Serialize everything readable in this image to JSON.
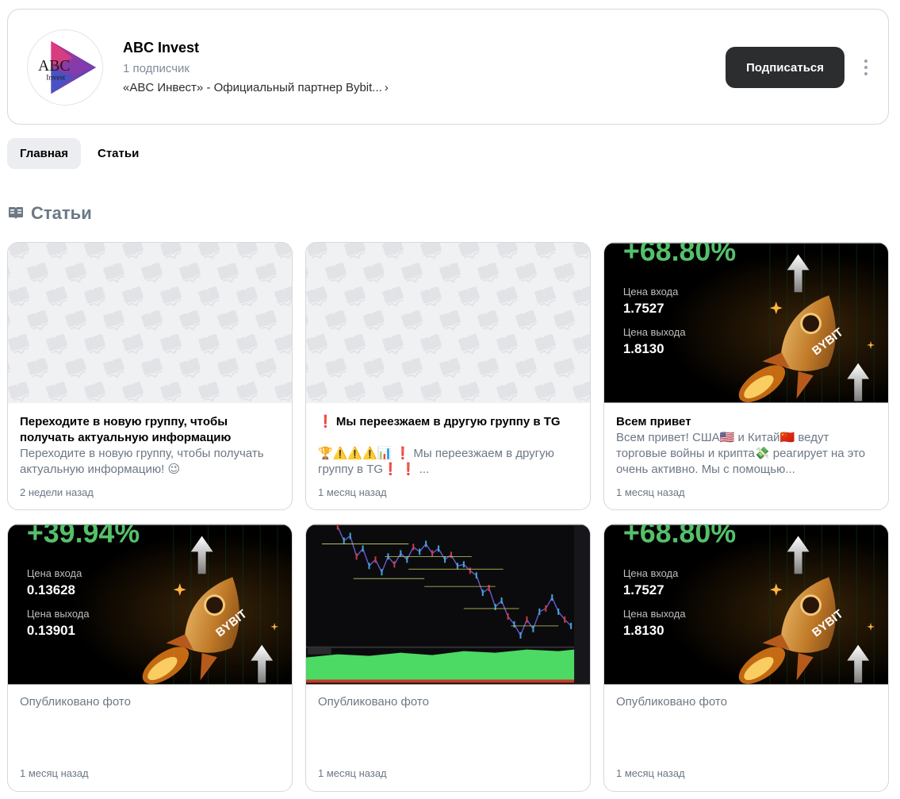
{
  "group": {
    "name": "ABC Invest",
    "subscribers": "1 подписчик",
    "description": "«ABC Инвест» -  Официальный партнер Bybit...",
    "logo_text_top": "ABC",
    "logo_text_bottom": "Invest",
    "subscribe_label": "Подписаться"
  },
  "tabs": [
    {
      "label": "Главная",
      "active": true
    },
    {
      "label": "Статьи",
      "active": false
    }
  ],
  "section": {
    "title": "Статьи",
    "icon": "book-icon"
  },
  "cards": [
    {
      "thumb": "placeholder",
      "title": "Переходите в новую группу, чтобы получать актуальную информацию",
      "body": "Переходите в новую группу, чтобы получать актуальную информацию! 😉",
      "time": "2 недели назад"
    },
    {
      "thumb": "placeholder",
      "title": "❗ Мы переезжаем в другую группу в TG",
      "body": "🏆⚠️⚠️⚠️📊 ❗ Мы переезжаем в другую группу в TG❗ ❗ ...",
      "time": "1 месяц назад"
    },
    {
      "thumb": "trade",
      "title": "Всем привет",
      "body": "Всем привет! США🇺🇸 и Китай🇨🇳 ведут торговые войны и крипта💸 реагирует на это очень активно. Мы с помощью...",
      "time": "1 месяц назад",
      "trade": {
        "percent": "+68.80%",
        "entry_label": "Цена входа",
        "entry": "1.7527",
        "exit_label": "Цена выхода",
        "exit": "1.8130",
        "brand": "BYBIT"
      }
    },
    {
      "thumb": "trade",
      "title": "",
      "body": "Опубликовано фото",
      "time": "1 месяц назад",
      "trade": {
        "percent": "+39.94%",
        "entry_label": "Цена входа",
        "entry": "0.13628",
        "exit_label": "Цена выхода",
        "exit": "0.13901",
        "brand": "BYBIT"
      }
    },
    {
      "thumb": "chart",
      "title": "",
      "body": "Опубликовано фото",
      "time": "1 месяц назад"
    },
    {
      "thumb": "trade",
      "title": "",
      "body": "Опубликовано фото",
      "time": "1 месяц назад",
      "trade": {
        "percent": "+68.80%",
        "entry_label": "Цена входа",
        "entry": "1.7527",
        "exit_label": "Цена выхода",
        "exit": "1.8130",
        "brand": "BYBIT"
      }
    }
  ],
  "colors": {
    "accent_dark": "#2c2d2e",
    "muted_text": "#6d7885",
    "trade_green": "#4bb34b",
    "card_border": "#d7d8db"
  }
}
